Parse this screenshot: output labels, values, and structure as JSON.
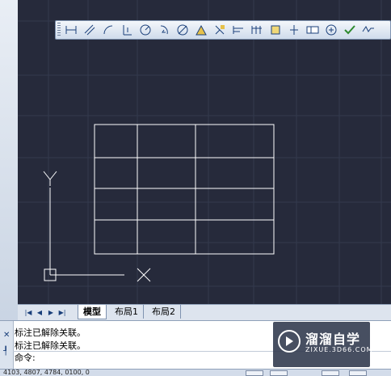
{
  "toolbar": {
    "buttons": [
      "linear-dimension-icon",
      "aligned-dimension-icon",
      "arc-length-icon",
      "ordinate-dimension-icon",
      "radius-dimension-icon",
      "jogged-dimension-icon",
      "diameter-dimension-icon",
      "angular-dimension-icon",
      "quick-dimension-icon",
      "baseline-dimension-icon",
      "continue-dimension-icon",
      "dimension-space-icon",
      "dimension-break-icon",
      "tolerance-icon",
      "center-mark-icon",
      "inspection-icon",
      "jogged-linear-icon"
    ]
  },
  "tabs": {
    "model": "模型",
    "layout1": "布局1",
    "layout2": "布局2"
  },
  "command": {
    "history": [
      "标注已解除关联。",
      "标注已解除关联。"
    ],
    "prompt": "命令:"
  },
  "ucs": {
    "x_label": "X",
    "y_label": "Y"
  },
  "status": {
    "coords": "4103, 4807, 4784, 0100, 0"
  },
  "watermark": {
    "title": "溜溜自学",
    "subtitle": "ZIXUE.3D66.COM"
  },
  "colors": {
    "canvas_bg": "#262a3b",
    "grid_line": "#343a4e",
    "drawing_line": "#ffffff"
  }
}
